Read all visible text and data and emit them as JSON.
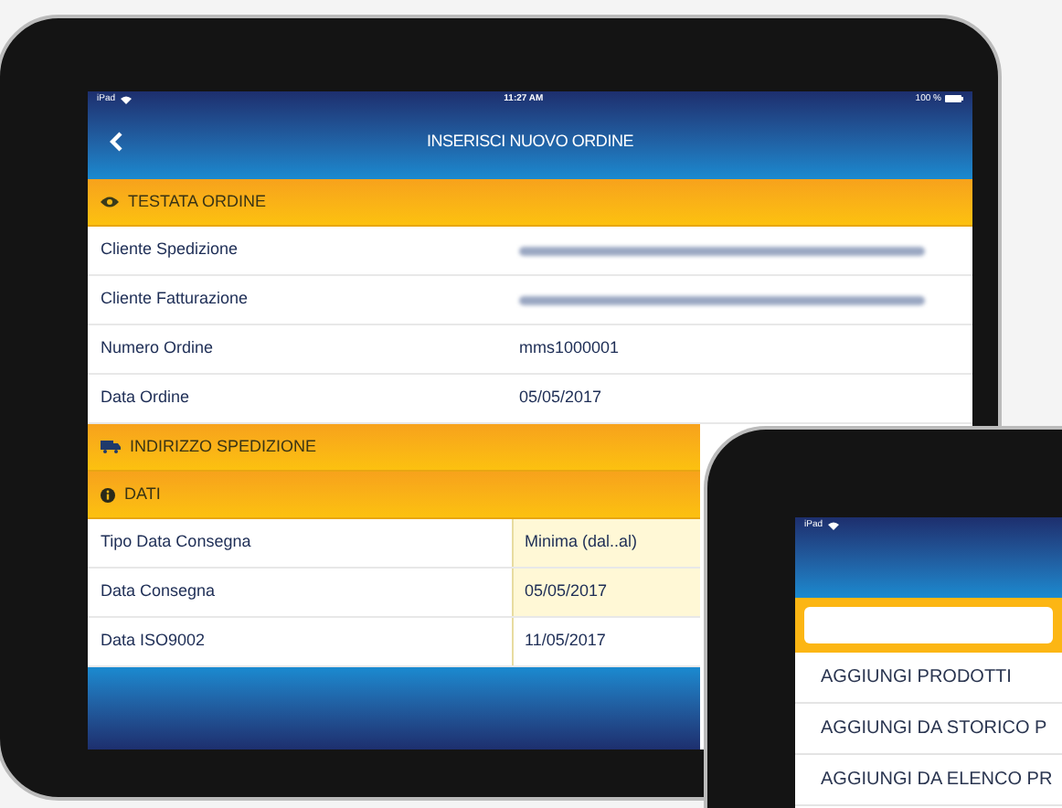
{
  "main_tablet": {
    "status_bar": {
      "device": "iPad",
      "time": "11:27 AM",
      "battery": "100 %"
    },
    "nav_title": "INSERISCI NUOVO ORDINE",
    "sections": [
      {
        "title": "TESTATA ORDINE",
        "rows": [
          {
            "label": "Cliente Spedizione",
            "kind": "redacted"
          },
          {
            "label": "Cliente Fatturazione",
            "kind": "redacted"
          },
          {
            "label": "Numero Ordine",
            "kind": "info",
            "value": "mms1000001"
          },
          {
            "label": "Data Ordine",
            "kind": "info",
            "value": "05/05/2017"
          }
        ]
      },
      {
        "title": "INDIRIZZO SPEDIZIONE"
      },
      {
        "title": "DATI",
        "rows": [
          {
            "label": "Tipo Data Consegna",
            "kind": "input",
            "value": "Minima (dal..al)",
            "highlighted": true
          },
          {
            "label": "Data Consegna",
            "kind": "input",
            "value": "05/05/2017",
            "highlighted": true
          },
          {
            "label": "Data ISO9002",
            "kind": "input",
            "value": "11/05/2017",
            "highlighted": false
          }
        ]
      }
    ]
  },
  "second_tablet": {
    "status_bar": {
      "device": "iPad"
    },
    "menu_items": [
      {
        "label": "AGGIUNGI PRODOTTI"
      },
      {
        "label": "AGGIUNGI DA STORICO P"
      },
      {
        "label": "AGGIUNGI DA ELENCO PR"
      }
    ]
  }
}
